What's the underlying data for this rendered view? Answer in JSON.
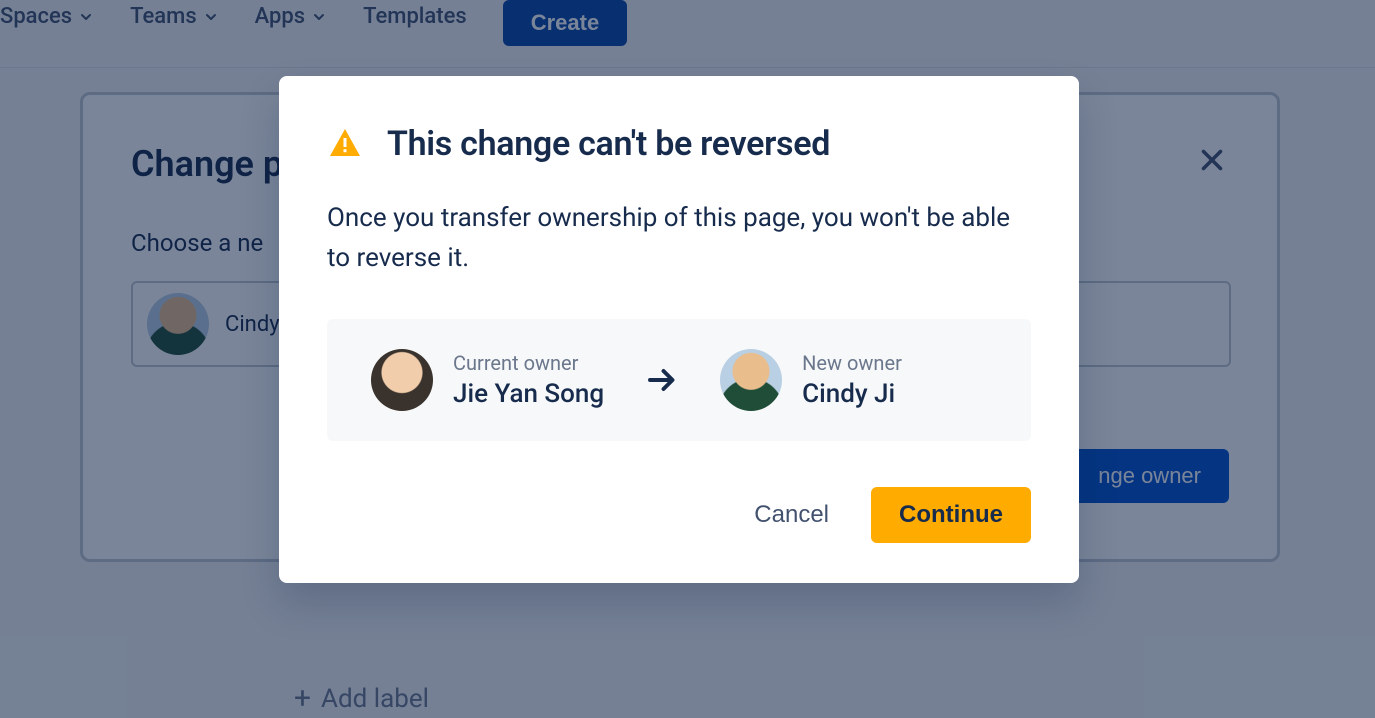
{
  "nav": {
    "items": [
      {
        "label": "Spaces",
        "has_chevron": true
      },
      {
        "label": "Teams",
        "has_chevron": true
      },
      {
        "label": "Apps",
        "has_chevron": true
      },
      {
        "label": "Templates",
        "has_chevron": false
      }
    ],
    "create_label": "Create"
  },
  "background_dialog": {
    "title_prefix": "Change p",
    "subtitle_prefix": "Choose a ne",
    "selected_name_prefix": "Cindy",
    "primary_button_suffix": "nge owner",
    "add_label": "Add label"
  },
  "modal": {
    "title": "This change can't be reversed",
    "body": "Once you transfer ownership of this page, you won't be able to reverse it.",
    "current_owner_label": "Current owner",
    "current_owner_name": "Jie Yan Song",
    "new_owner_label": "New owner",
    "new_owner_name": "Cindy Ji",
    "cancel_label": "Cancel",
    "continue_label": "Continue"
  },
  "colors": {
    "primary": "#0052cc",
    "primary_dark": "#0747a6",
    "warning": "#ffab00",
    "text": "#172b4d",
    "subtle": "#6b778c"
  }
}
